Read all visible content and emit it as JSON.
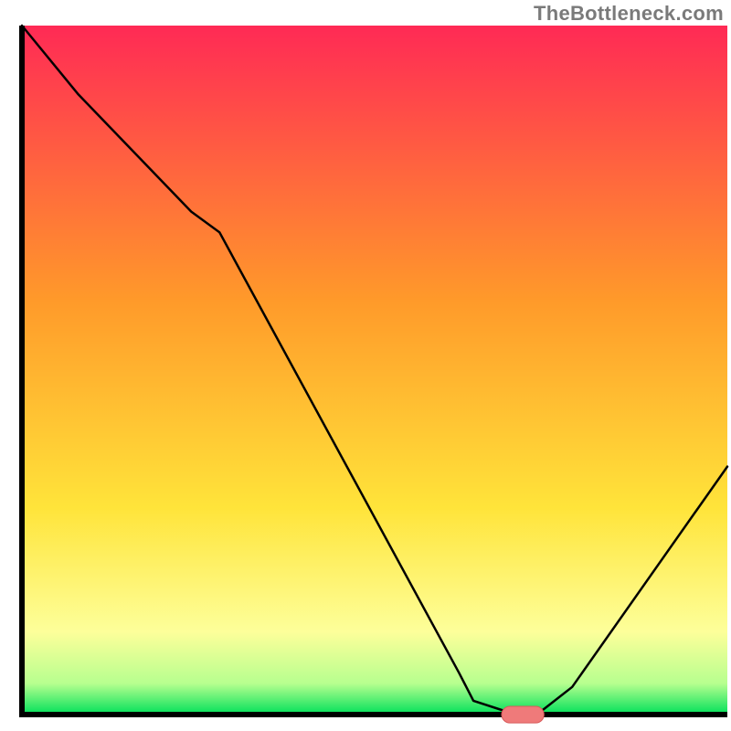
{
  "watermark": "TheBottleneck.com",
  "chart_data": {
    "type": "line",
    "title": "",
    "xlabel": "",
    "ylabel": "",
    "xlim": [
      0,
      100
    ],
    "ylim": [
      0,
      100
    ],
    "grid": false,
    "legend": false,
    "background_gradient_stops": [
      {
        "offset": 0.0,
        "color": "#ff2a55"
      },
      {
        "offset": 0.4,
        "color": "#ff9a2a"
      },
      {
        "offset": 0.7,
        "color": "#ffe43a"
      },
      {
        "offset": 0.88,
        "color": "#fdff9a"
      },
      {
        "offset": 0.955,
        "color": "#b7ff8f"
      },
      {
        "offset": 1.0,
        "color": "#00e05a"
      }
    ],
    "series": [
      {
        "name": "bottleneck-curve",
        "color": "#000000",
        "stroke_width": 2.5,
        "x": [
          0,
          8,
          24,
          28,
          62,
          64,
          70,
          73,
          78,
          100
        ],
        "y": [
          100,
          90,
          73,
          70,
          6,
          2,
          0,
          0,
          4,
          36
        ]
      }
    ],
    "marker": {
      "name": "optimal-range",
      "color_fill": "#ef7a7a",
      "color_stroke": "#d85a5a",
      "x_center": 71,
      "y_center": 0,
      "width": 6,
      "height": 2.4,
      "rx": 1.2
    },
    "axes": {
      "color": "#000000",
      "width": 6
    }
  }
}
